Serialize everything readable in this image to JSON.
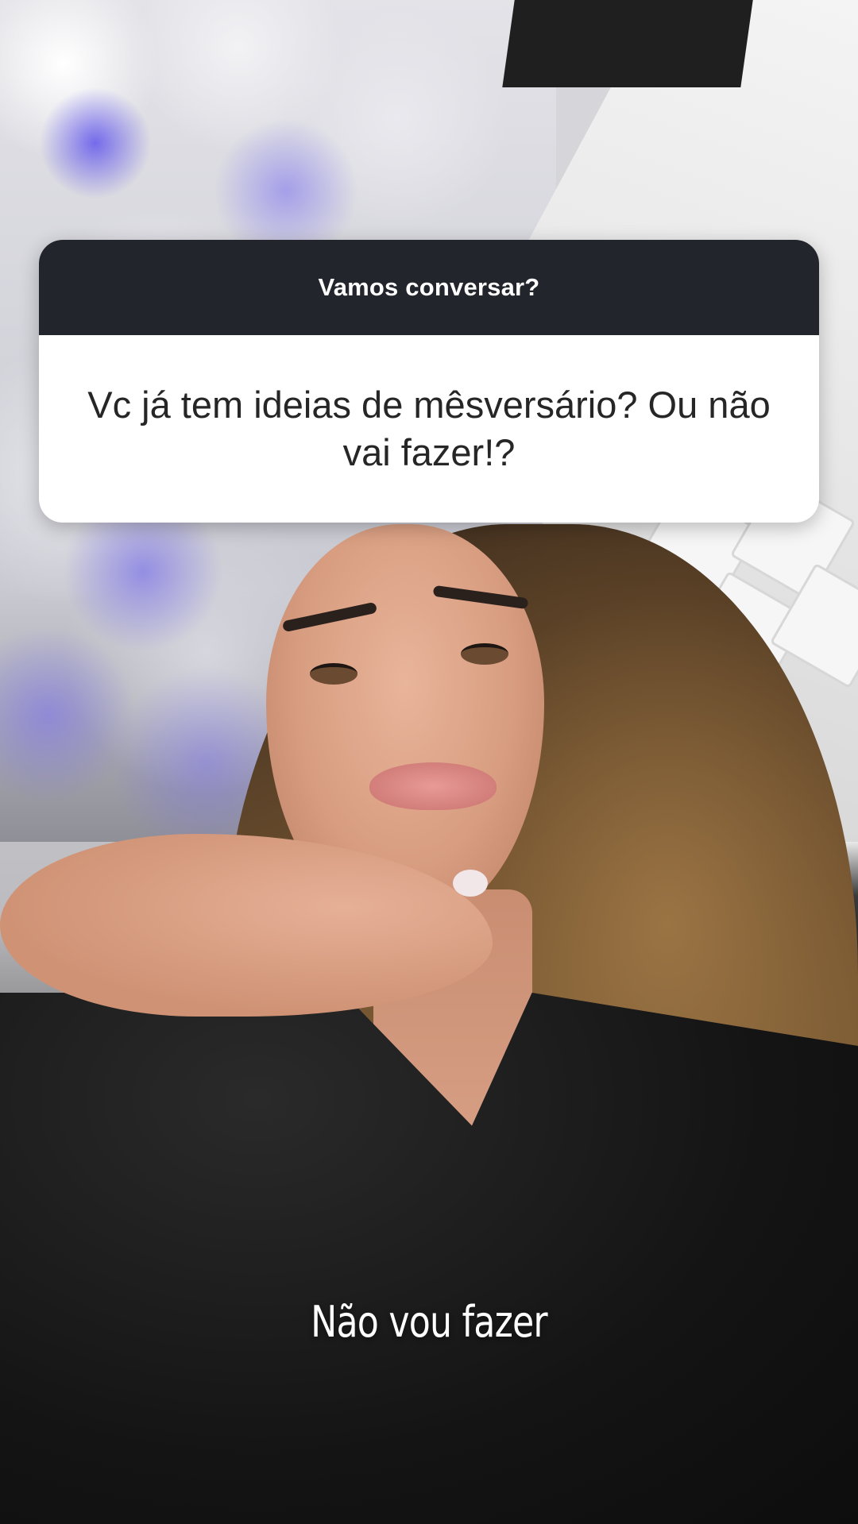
{
  "question_sticker": {
    "title": "Vamos conversar?",
    "question": "Vc já tem ideias de mêsversário? Ou não vai fazer!?"
  },
  "caption": {
    "text": "Não vou fazer"
  },
  "colors": {
    "sticker_header": "#22262c",
    "sticker_body": "#ffffff",
    "sticker_title_text": "#ffffff",
    "question_text": "#262626",
    "caption_text": "#ffffff"
  }
}
